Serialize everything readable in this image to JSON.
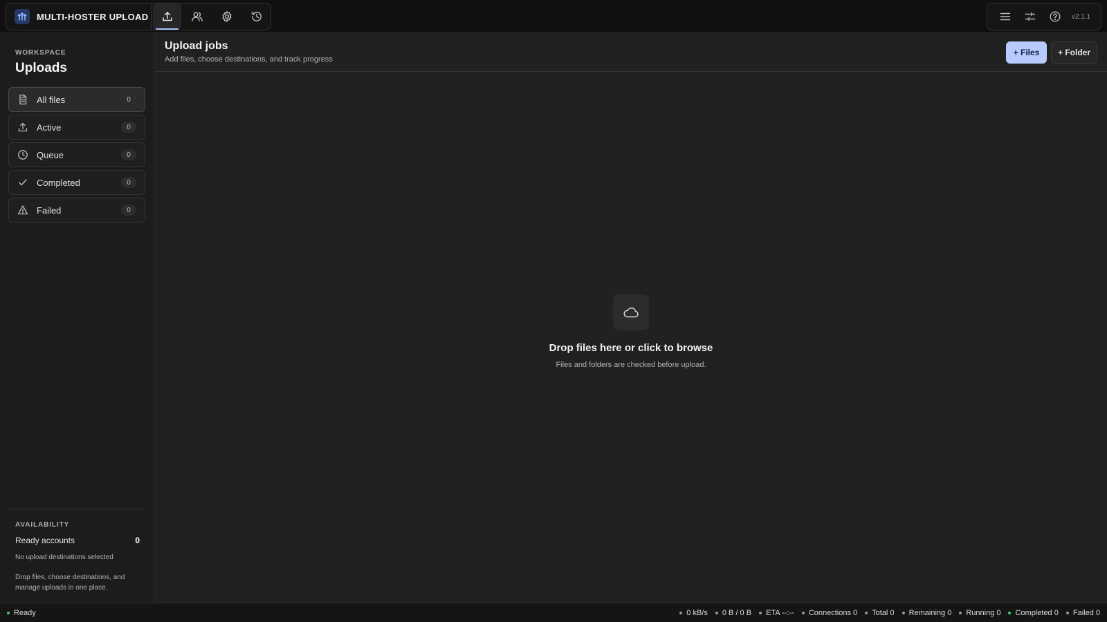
{
  "app": {
    "name": "MULTI-HOSTER UPLOAD",
    "version": "v2.1.1",
    "accent": "#b7cbff"
  },
  "nav_tabs": [
    {
      "icon": "upload-icon",
      "active": true
    },
    {
      "icon": "users-icon",
      "active": false
    },
    {
      "icon": "gear-icon",
      "active": false
    },
    {
      "icon": "history-icon",
      "active": false
    }
  ],
  "toolbar": {
    "icons": [
      "menu-icon",
      "sliders-icon",
      "help-icon"
    ]
  },
  "sidebar": {
    "section_label": "WORKSPACE",
    "title": "Uploads",
    "items": [
      {
        "label": "All files",
        "count": "0",
        "icon": "file-icon",
        "selected": true
      },
      {
        "label": "Active",
        "count": "0",
        "icon": "upload-icon"
      },
      {
        "label": "Queue",
        "count": "0",
        "icon": "clock-icon"
      },
      {
        "label": "Completed",
        "count": "0",
        "icon": "check-icon"
      },
      {
        "label": "Failed",
        "count": "0",
        "icon": "warning-icon"
      }
    ],
    "availability": {
      "label": "AVAILABILITY",
      "ready_label": "Ready accounts",
      "ready_count": "0",
      "no_destinations": "No upload destinations selected",
      "note": "Drop files, choose destinations, and manage uploads in one place."
    }
  },
  "main": {
    "title": "Upload jobs",
    "subtitle": "Add files, choose destinations, and track progress",
    "add_files_label": "+ Files",
    "add_folder_label": "+ Folder",
    "dropzone": {
      "icon": "cloud-icon",
      "title": "Drop files here or click to browse",
      "subtitle": "Files and folders are checked before upload."
    }
  },
  "statusbar": {
    "state": "Ready",
    "speed": "0 kB/s",
    "bytes": "0 B / 0 B",
    "eta": "ETA --:--",
    "connections": "Connections 0",
    "total": "Total 0",
    "remaining": "Remaining 0",
    "running": "Running 0",
    "completed": "Completed 0",
    "failed": "Failed 0",
    "ready_color": "#3ecf72"
  }
}
